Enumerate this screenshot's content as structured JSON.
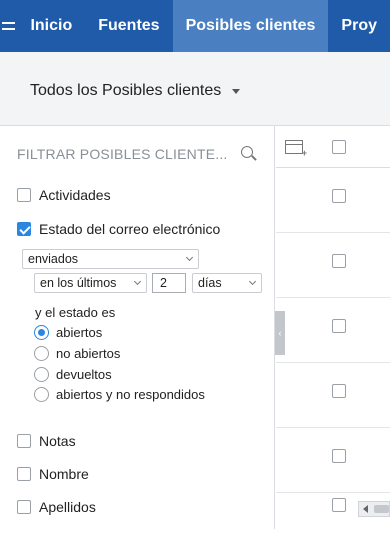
{
  "nav": {
    "tabs": [
      {
        "label": "Inicio"
      },
      {
        "label": "Fuentes"
      },
      {
        "label": "Posibles clientes"
      },
      {
        "label": "Proy"
      }
    ],
    "active_index": 2
  },
  "view": {
    "selected": "Todos los Posibles clientes"
  },
  "filter": {
    "title": "FILTRAR POSIBLES CLIENTE...",
    "fields": [
      {
        "label": "Actividades",
        "checked": false
      },
      {
        "label": "Estado del correo electrónico",
        "checked": true
      },
      {
        "label": "Notas",
        "checked": false
      },
      {
        "label": "Nombre",
        "checked": false
      },
      {
        "label": "Apellidos",
        "checked": false
      }
    ],
    "email_status": {
      "status_select": "enviados",
      "range_select": "en los últimos",
      "number": "2",
      "unit_select": "días",
      "state_label": "y el estado es",
      "options": [
        {
          "label": "abiertos",
          "selected": true
        },
        {
          "label": "no abiertos",
          "selected": false
        },
        {
          "label": "devueltos",
          "selected": false
        },
        {
          "label": "abiertos y no respondidos",
          "selected": false
        }
      ]
    }
  },
  "collapse_handle": {
    "glyph": "‹"
  },
  "colors": {
    "nav_bg": "#1f5ba9",
    "nav_active": "#4a7fc2",
    "accent": "#2b86e0"
  }
}
